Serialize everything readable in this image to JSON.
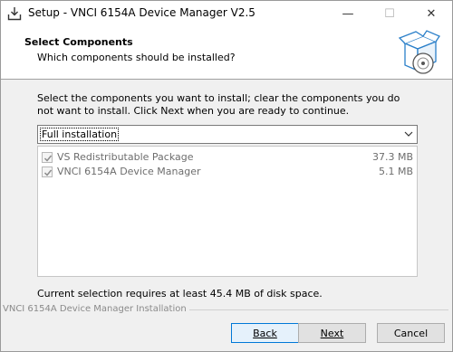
{
  "window": {
    "title": "Setup - VNCI 6154A Device Manager V2.5",
    "minimize_glyph": "—",
    "maximize_glyph": "☐",
    "close_glyph": "✕"
  },
  "header": {
    "title": "Select Components",
    "subtitle": "Which components should be installed?",
    "icon": "box-with-cd-icon"
  },
  "body": {
    "description": "Select the components you want to install; clear the components you do not want to install. Click Next when you are ready to continue.",
    "installation_type": {
      "selected": "Full installation"
    },
    "components": [
      {
        "label": "VS Redistributable Package",
        "size": "37.3 MB",
        "checked": true,
        "enabled": false
      },
      {
        "label": "VNCI 6154A Device Manager",
        "size": "5.1 MB",
        "checked": true,
        "enabled": false
      }
    ],
    "space_required": "Current selection requires at least 45.4 MB of disk space."
  },
  "footer": {
    "group_label": "VNCI 6154A Device Manager Installation",
    "back_label": "Back",
    "next_label": "Next",
    "cancel_label": "Cancel"
  },
  "colors": {
    "accent": "#0078d7",
    "disabled_text": "#6d6d6d"
  }
}
